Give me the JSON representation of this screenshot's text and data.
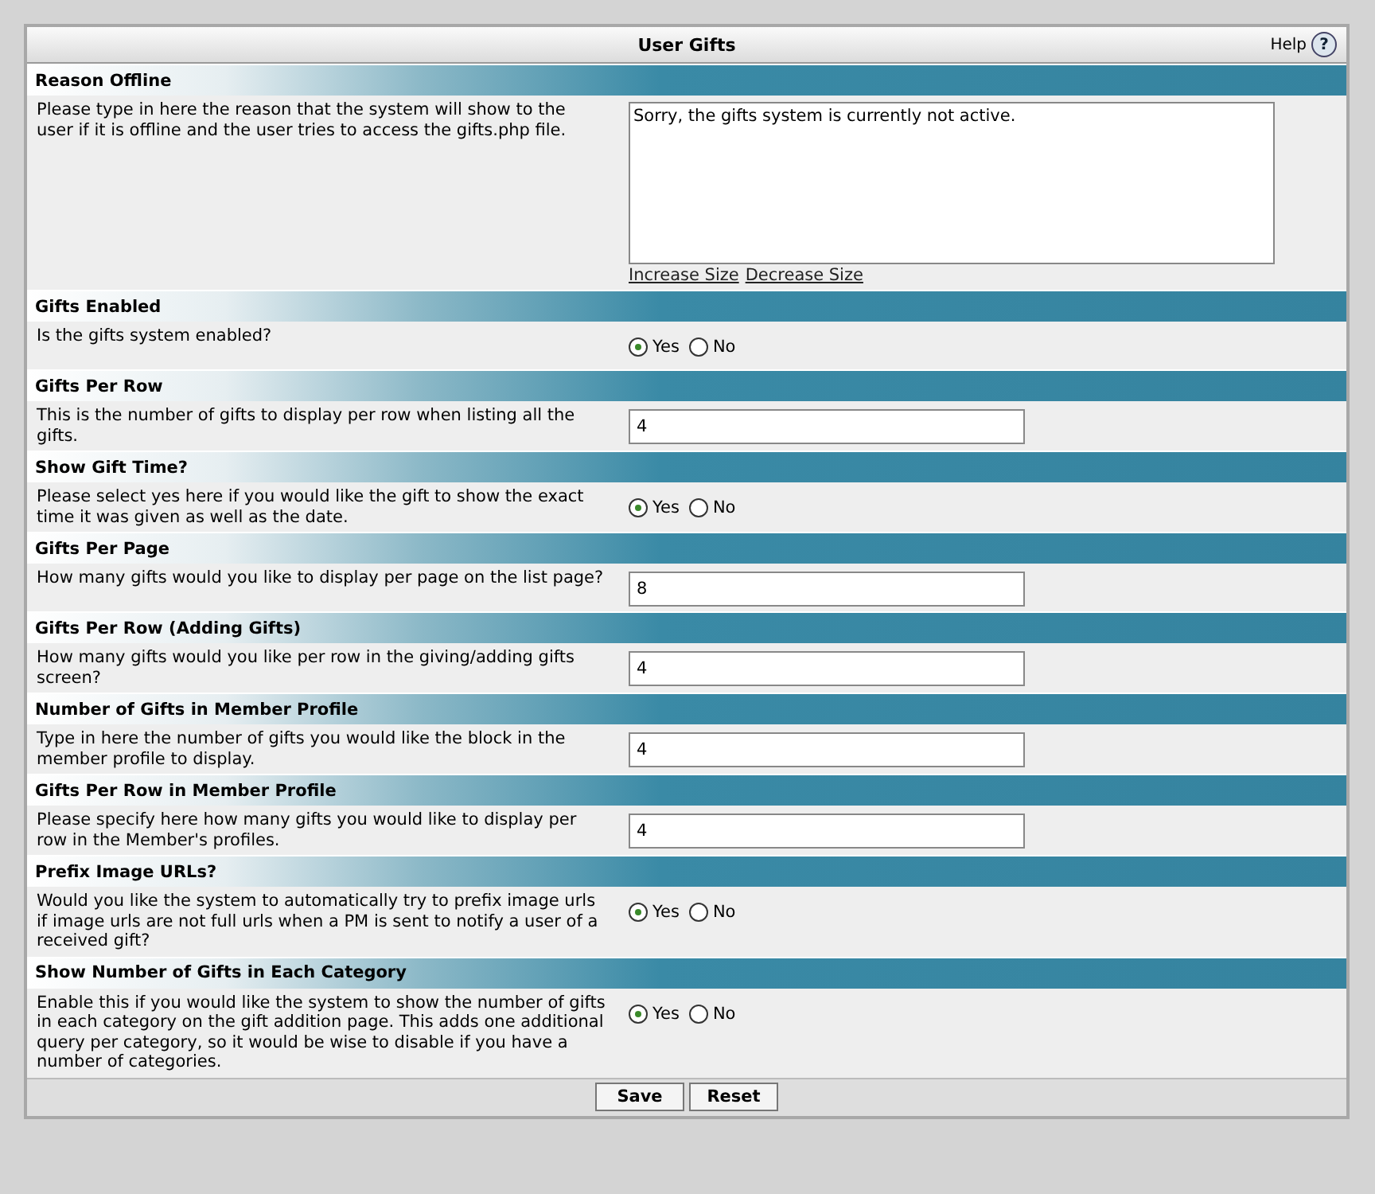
{
  "title": "User Gifts",
  "help": {
    "label": "Help",
    "icon": "?"
  },
  "settings": [
    {
      "heading": "Reason Offline",
      "description": "Please type in here the reason that the system will show to the user if it is offline and the user tries to access the gifts.php file.",
      "kind": "textarea",
      "value": "Sorry, the gifts system is currently not active.",
      "links": [
        "Increase Size",
        "Decrease Size"
      ]
    },
    {
      "heading": "Gifts Enabled",
      "description": "Is the gifts system enabled?",
      "kind": "yesno",
      "options": [
        {
          "label": "Yes",
          "selected": true
        },
        {
          "label": "No",
          "selected": false
        }
      ]
    },
    {
      "heading": "Gifts Per Row",
      "description": "This is the number of gifts to display per row when listing all the gifts.",
      "kind": "text",
      "value": "4"
    },
    {
      "heading": "Show Gift Time?",
      "description": "Please select yes here if you would like the gift to show the exact time it was given as well as the date.",
      "kind": "yesno",
      "options": [
        {
          "label": "Yes",
          "selected": true
        },
        {
          "label": "No",
          "selected": false
        }
      ]
    },
    {
      "heading": "Gifts Per Page",
      "description": "How many gifts would you like to display per page on the list page?",
      "kind": "text",
      "value": "8"
    },
    {
      "heading": "Gifts Per Row (Adding Gifts)",
      "description": "How many gifts would you like per row in the giving/adding gifts screen?",
      "kind": "text",
      "value": "4"
    },
    {
      "heading": "Number of Gifts in Member Profile",
      "description": "Type in here the number of gifts you would like the block in the member profile to display.",
      "kind": "text",
      "value": "4"
    },
    {
      "heading": "Gifts Per Row in Member Profile",
      "description": "Please specify here how many gifts you would like to display per row in the Member's profiles.",
      "kind": "text",
      "value": "4"
    },
    {
      "heading": "Prefix Image URLs?",
      "description": "Would you like the system to automatically try to prefix image urls if image urls are not full urls when a PM is sent to notify a user of a received gift?",
      "kind": "yesno",
      "options": [
        {
          "label": "Yes",
          "selected": true
        },
        {
          "label": "No",
          "selected": false
        }
      ]
    },
    {
      "heading": "Show Number of Gifts in Each Category",
      "description": "Enable this if you would like the system to show the number of gifts in each category on the gift addition page. This adds one additional query per category, so it would be wise to disable if you have a number of categories.",
      "kind": "yesno",
      "options": [
        {
          "label": "Yes",
          "selected": true
        },
        {
          "label": "No",
          "selected": false
        }
      ]
    }
  ],
  "buttons": [
    "Save",
    "Reset"
  ]
}
